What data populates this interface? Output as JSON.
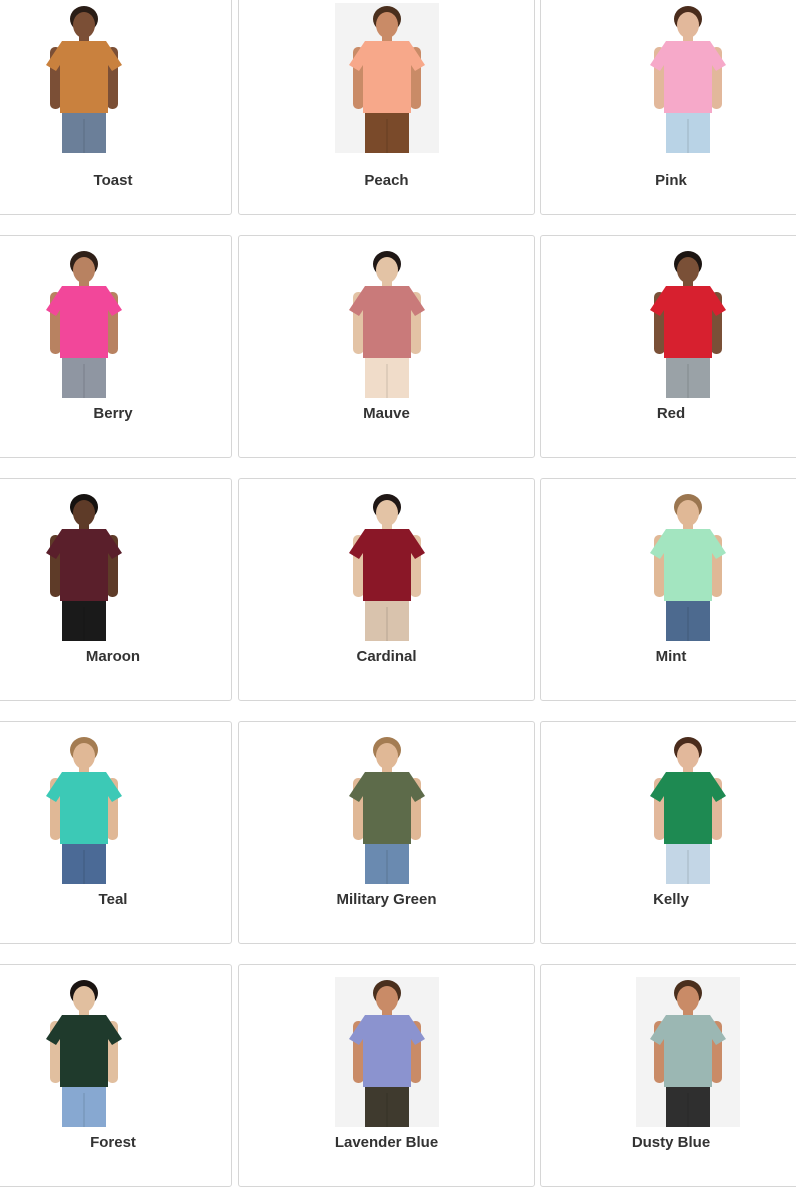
{
  "swatches": [
    {
      "label": "Toast",
      "shirt": "#c9813e",
      "pants": "#6b7f99",
      "hair": "#2a1d16",
      "skin": "#7b4f36",
      "bg": "#ffffff"
    },
    {
      "label": "Peach",
      "shirt": "#f7a88a",
      "pants": "#7a4a2a",
      "hair": "#4a2f1d",
      "skin": "#c98b67",
      "bg": "#f3f3f3"
    },
    {
      "label": "Pink",
      "shirt": "#f6a9c9",
      "pants": "#b9d3e6",
      "hair": "#4a2c1c",
      "skin": "#e2b89b",
      "bg": "#ffffff"
    },
    {
      "label": "Berry",
      "shirt": "#f2479a",
      "pants": "#8f96a2",
      "hair": "#2f2018",
      "skin": "#b88261",
      "bg": "#ffffff"
    },
    {
      "label": "Mauve",
      "shirt": "#c97a7a",
      "pants": "#f0dcc9",
      "hair": "#1f1715",
      "skin": "#e3c3a5",
      "bg": "#ffffff"
    },
    {
      "label": "Red",
      "shirt": "#d7202f",
      "pants": "#9aa2a7",
      "hair": "#1c1512",
      "skin": "#7a5037",
      "bg": "#ffffff"
    },
    {
      "label": "Maroon",
      "shirt": "#5a1f2b",
      "pants": "#1a1a1a",
      "hair": "#161210",
      "skin": "#5e3b28",
      "bg": "#ffffff"
    },
    {
      "label": "Cardinal",
      "shirt": "#8a1727",
      "pants": "#d9c3ad",
      "hair": "#1f1715",
      "skin": "#e3c3a5",
      "bg": "#ffffff"
    },
    {
      "label": "Mint",
      "shirt": "#a3e5c0",
      "pants": "#4d6a8f",
      "hair": "#9b7650",
      "skin": "#e0b896",
      "bg": "#ffffff"
    },
    {
      "label": "Teal",
      "shirt": "#3cc9b6",
      "pants": "#4b6a96",
      "hair": "#a47c52",
      "skin": "#e0b896",
      "bg": "#ffffff"
    },
    {
      "label": "Military Green",
      "shirt": "#5d6b4a",
      "pants": "#6a8ab0",
      "hair": "#a47c52",
      "skin": "#e0b896",
      "bg": "#ffffff"
    },
    {
      "label": "Kelly",
      "shirt": "#1e8a52",
      "pants": "#c3d6e6",
      "hair": "#4a2c1c",
      "skin": "#e2b89b",
      "bg": "#ffffff"
    },
    {
      "label": "Forest",
      "shirt": "#1f3a2c",
      "pants": "#87a8d1",
      "hair": "#1a1412",
      "skin": "#e1bf9f",
      "bg": "#ffffff"
    },
    {
      "label": "Lavender Blue",
      "shirt": "#8b93cf",
      "pants": "#3f3a2e",
      "hair": "#4a2f1d",
      "skin": "#c98b67",
      "bg": "#f3f3f3"
    },
    {
      "label": "Dusty Blue",
      "shirt": "#9bb7b3",
      "pants": "#2f2f2f",
      "hair": "#4a2f1d",
      "skin": "#c98b67",
      "bg": "#f3f3f3"
    }
  ]
}
